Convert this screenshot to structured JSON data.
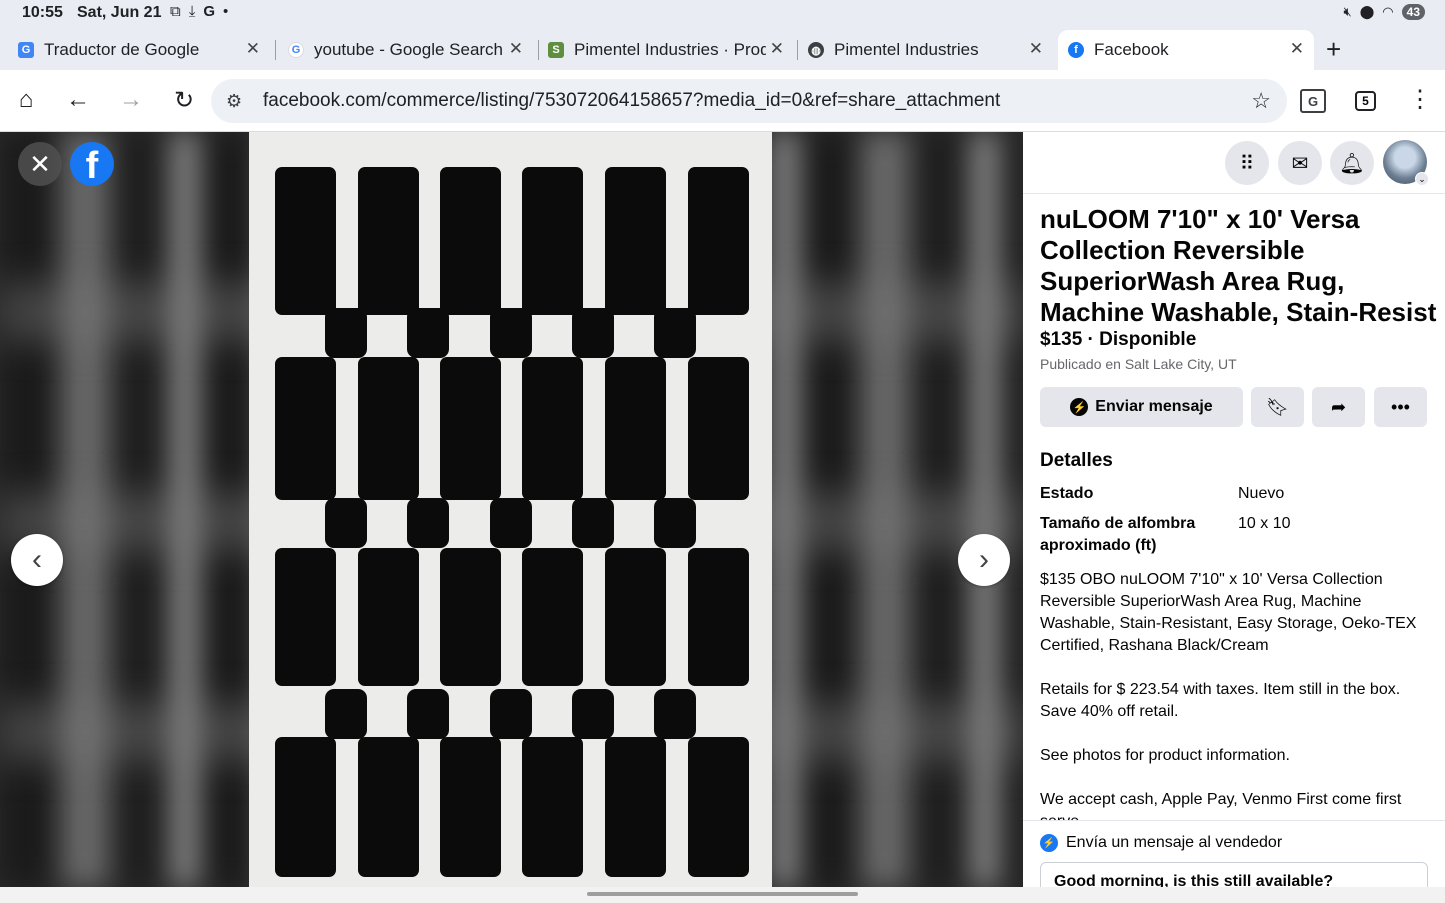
{
  "status_bar": {
    "time": "10:55",
    "date": "Sat, Jun 21",
    "battery": "43"
  },
  "tabs": [
    {
      "label": "Traductor de Google",
      "favicon": "google-translate-icon",
      "active": false
    },
    {
      "label": "youtube - Google Search",
      "favicon": "google-g-icon",
      "active": false
    },
    {
      "label": "Pimentel Industries · Products",
      "favicon": "shopify-bag-icon",
      "active": false
    },
    {
      "label": "Pimentel Industries",
      "favicon": "globe-icon",
      "active": false
    },
    {
      "label": "Facebook",
      "favicon": "facebook-icon",
      "active": true
    }
  ],
  "toolbar": {
    "url": "facebook.com/commerce/listing/753072064158657?media_id=0&ref=share_attachment",
    "tab_count": "5"
  },
  "listing": {
    "title": "nuLOOM 7'10\" x 10' Versa Collection Reversible SuperiorWash Area Rug, Machine Washable, Stain-Resist",
    "price": "$135",
    "availability": " · Disponible",
    "location": "Publicado en Salt Lake City, UT",
    "send_message_label": "Enviar mensaje",
    "details_title": "Detalles",
    "details": [
      {
        "key": "Estado",
        "value": "Nuevo"
      },
      {
        "key": "Tamaño de alfombra aproximado (ft)",
        "value": "10 x 10"
      }
    ],
    "description": [
      "$135 OBO nuLOOM 7'10\" x 10' Versa Collection Reversible SuperiorWash Area Rug, Machine Washable, Stain-Resistant, Easy Storage, Oeko-TEX Certified, Rashana Black/Cream",
      "Retails for $ 223.54 with taxes. Item still in the box. Save 40% off retail.",
      "See photos for product information.",
      "We accept cash, Apple Pay, Venmo   First come first serve"
    ]
  },
  "message_seller": {
    "heading": "Envía un mensaje al vendedor",
    "draft": "Good morning, is this still available?"
  },
  "colors": {
    "facebook_blue": "#1877f2",
    "chrome_frame": "#e9ecf3",
    "button_gray": "#e4e6eb"
  }
}
